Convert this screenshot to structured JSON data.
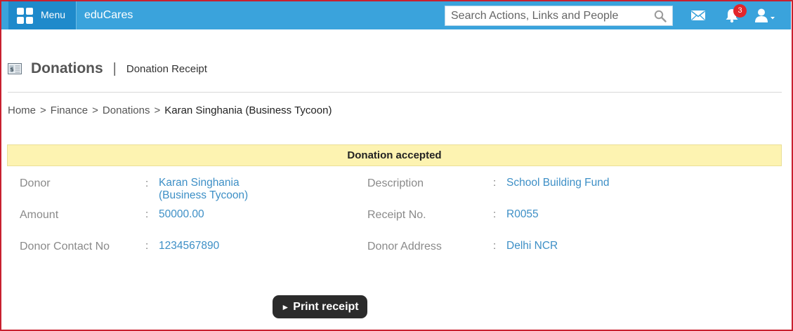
{
  "header": {
    "menu_label": "Menu",
    "brand": "eduCares",
    "search_placeholder": "Search Actions, Links and People",
    "notification_count": "3",
    "icons": [
      "menu-grid-icon",
      "search-icon",
      "mail-icon",
      "bell-icon",
      "user-icon"
    ]
  },
  "page": {
    "title": "Donations",
    "separator": "|",
    "subtitle": "Donation Receipt"
  },
  "breadcrumb": {
    "items": [
      "Home",
      "Finance",
      "Donations"
    ],
    "current": "Karan Singhania (Business Tycoon)",
    "separator": ">"
  },
  "notice": "Donation accepted",
  "receipt": {
    "colon": ":",
    "donor": {
      "label": "Donor",
      "value_line1": "Karan Singhania",
      "value_line2": "(Business Tycoon)"
    },
    "description": {
      "label": "Description",
      "value": "School Building Fund"
    },
    "amount": {
      "label": "Amount",
      "value": "50000.00"
    },
    "receipt_no": {
      "label": "Receipt No.",
      "value": "R0055"
    },
    "contact": {
      "label": "Donor Contact No",
      "value": "1234567890"
    },
    "address": {
      "label": "Donor Address",
      "value": "Delhi NCR"
    }
  },
  "actions": {
    "print_label": "Print receipt",
    "print_icon": "►"
  },
  "colors": {
    "topbar": "#3aa3dc",
    "menu_bg": "#1f8acb",
    "badge": "#e2262b",
    "notice_bg": "#fdf3b1",
    "value_text": "#3d8fc6",
    "frame_border": "#c8202f",
    "button_bg": "#2b2b2b"
  }
}
